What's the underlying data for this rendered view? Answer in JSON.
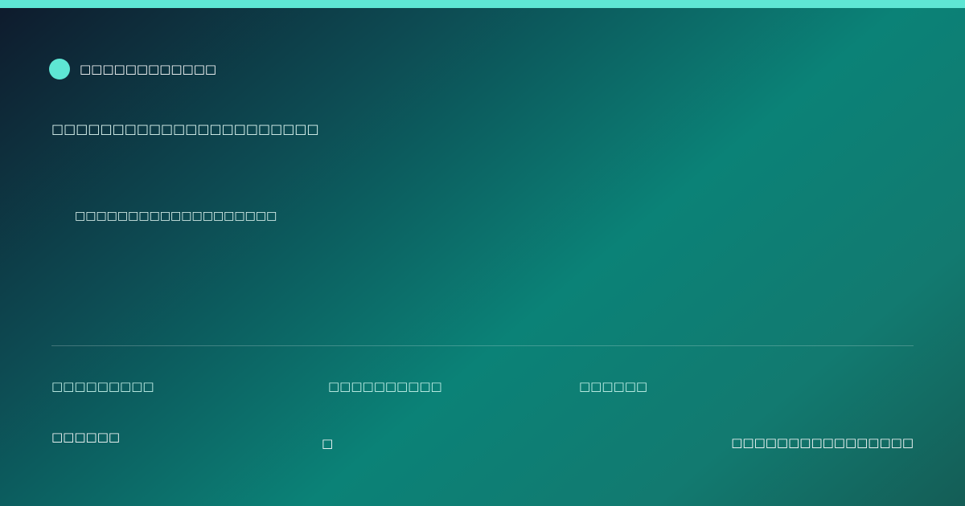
{
  "colors": {
    "accent": "#5ee6d4",
    "background_start": "#0e1a2c",
    "background_mid": "#0b8277",
    "background_end": "#145d56"
  },
  "brand": {
    "icon": "brand-dot-icon",
    "name": "□□□□□□□□□□□□"
  },
  "headline": "□□□□□□□□□□□□□□□□□□□□□□",
  "subtext": "□□□□□□□□□□□□□□□□□□□",
  "meta": [
    "□□□□□□□□□",
    "□□□□□□□□□□",
    "□□□□□□"
  ],
  "footer": {
    "left": "□□□□□□",
    "middle": "□",
    "right": "□□□□□□□□□□□□□□□□"
  }
}
